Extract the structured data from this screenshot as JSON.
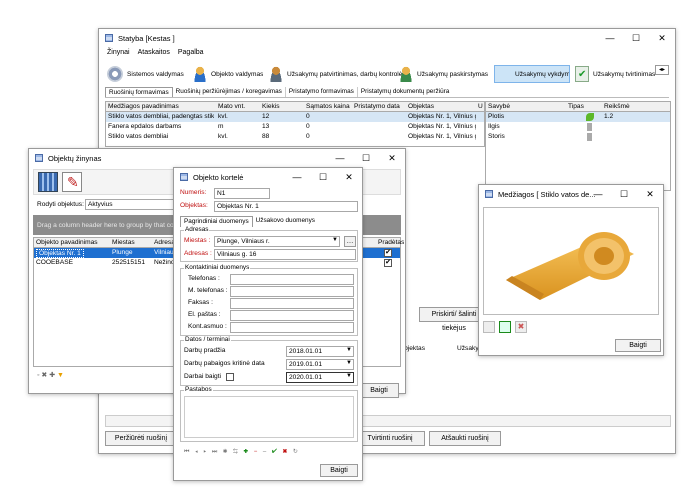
{
  "main": {
    "title": "Statyba [Kestas ]",
    "menu": [
      "Žinynai",
      "Ataskaitos",
      "Pagalba"
    ],
    "toolbar": [
      "Sistemos valdymas",
      "Objekto valdymas",
      "Užsakymų patvirtinimas, darbų kontrolė",
      "Užsakymų paskirstymas",
      "Užsakymų vykdymas",
      "Užsakymų tvirtinimas"
    ],
    "tabs": [
      "Ruošinių formavimas",
      "Ruošinių peržiūrėjimas / koregavimas",
      "Pristatymo formavimas",
      "Pristatymų dokumentų peržiūra"
    ],
    "grid_headers": [
      "Medžiagos pavadinimas",
      "Mato vnt.",
      "Kiekis",
      "Sąmatos kaina",
      "Pristatymo data",
      "Objektas",
      "U"
    ],
    "grid_rows": [
      [
        "Stiklo vatos dembliai, padengtas stiklo au",
        "kvl.",
        "12",
        "0",
        "",
        "Objektas Nr. 1, Vilnius g."
      ],
      [
        "Fanera epdalos darbams",
        "m",
        "13",
        "0",
        "",
        "Objektas Nr. 1, Vilnius g."
      ],
      [
        "Stiklo vatos dembliai",
        "kvl.",
        "88",
        "0",
        "",
        "Objektas Nr. 1, Vilnius g."
      ]
    ],
    "prop_headers": [
      "Savybė",
      "Tipas",
      "Reikšmė"
    ],
    "prop_rows": [
      [
        "Plotis",
        "",
        "1.2"
      ],
      [
        "Ilgis",
        "",
        ""
      ],
      [
        "Storis",
        "",
        ""
      ]
    ],
    "bottom_buttons": [
      "Peržiūrėti ruošinį",
      "Tvirtinti ruošinį",
      "Atšaukti ruošinį"
    ],
    "mid_button": "Priskirti/ šalinti tiekėjus",
    "col_objektas": "Objektas",
    "col_uzsaky": "Užsaky"
  },
  "zinynas": {
    "title": "Objektų žinynas",
    "filter_label": "Rodyti objektus:",
    "filter_value": "Aktyvius",
    "group_hint": "Drag a column header here to group by that column",
    "headers": [
      "Objekto pavadinimas",
      "Miestas",
      "Adresas",
      "Pradėtas"
    ],
    "rows": [
      [
        "Objektas Nr. 1",
        "Plunge",
        "Vilniaus g."
      ],
      [
        "COOEBASE",
        "252515151",
        "Nežinoma"
      ]
    ],
    "close": "Baigti"
  },
  "kortele": {
    "title": "Objekto kortelė",
    "numeris_label": "Numeris:",
    "numeris": "N1",
    "objektas_label": "Objektas:",
    "objektas": "Objektas Nr. 1",
    "tabs": [
      "Pagrindiniai duomenys",
      "Užsakovo duomenys"
    ],
    "adresas_group": "Adresas",
    "miestas_label": "Miestas :",
    "miestas": "Plunge, Vilniaus r.",
    "adresas_label": "Adresas :",
    "adresas": "Vilniaus g. 16",
    "kontakt_group": "Kontaktiniai duomenys",
    "kontakt_labels": [
      "Telefonas :",
      "M. telefonas :",
      "Faksas :",
      "El. paštas :",
      "Kont.asmuo :"
    ],
    "datos_group": "Datos / terminai",
    "darbu_pradzia": "Darbų pradžia",
    "pradzia": "2018.01.01",
    "darbu_pabaiga": "Darbų pabaigos kritinė data",
    "pabaiga": "2019.01.01",
    "darbai_baigti": "Darbai baigti",
    "baigti_data": "2020.01.01",
    "pastabos": "Pastabos",
    "close": "Baigti"
  },
  "medziagos": {
    "title": "Medžiagos [ Stiklo vatos de...",
    "close": "Baigti"
  }
}
